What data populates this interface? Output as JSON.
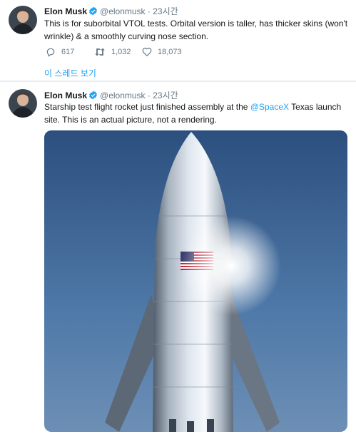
{
  "tweets": [
    {
      "author_name": "Elon Musk",
      "handle": "@elonmusk",
      "separator": "·",
      "time": "23시간",
      "text": "This is for suborbital VTOL tests. Orbital version is taller, has thicker skins (won't wrinkle) & a smoothly curving nose section.",
      "reply_count": "617",
      "retweet_count": "1,032",
      "like_count": "18,073",
      "show_thread": "이 스레드 보기"
    },
    {
      "author_name": "Elon Musk",
      "handle": "@elonmusk",
      "separator": "·",
      "time": "23시간",
      "text_before": "Starship test flight rocket just finished assembly at the ",
      "mention": "@SpaceX",
      "text_after": " Texas launch site. This is an actual picture, not a rendering."
    }
  ],
  "colors": {
    "accent": "#1da1f2",
    "muted": "#657786",
    "text": "#14171a",
    "divider": "#e6ecf0"
  },
  "icons": [
    "verified-badge-icon",
    "reply-icon",
    "retweet-icon",
    "like-icon"
  ]
}
